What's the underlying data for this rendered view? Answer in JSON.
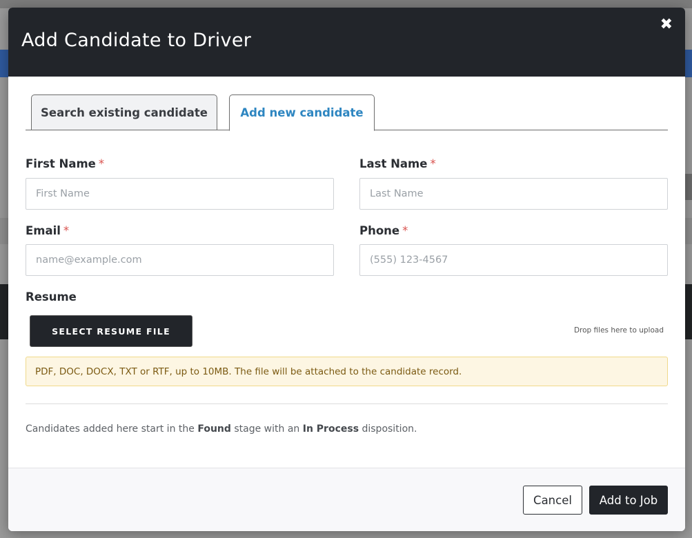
{
  "modal": {
    "title": "Add Candidate to Driver",
    "close_symbol": "✖"
  },
  "tabs": [
    {
      "label": "Search existing candidate",
      "active": false
    },
    {
      "label": "Add new candidate",
      "active": true
    }
  ],
  "form": {
    "first_name": {
      "label": "First Name",
      "required": "*",
      "placeholder": "First Name",
      "value": ""
    },
    "last_name": {
      "label": "Last Name",
      "required": "*",
      "placeholder": "Last Name",
      "value": ""
    },
    "email": {
      "label": "Email",
      "required": "*",
      "placeholder": "name@example.com",
      "value": ""
    },
    "phone": {
      "label": "Phone",
      "required": "*",
      "placeholder": "(555) 123-4567",
      "value": ""
    },
    "resume": {
      "label": "Resume",
      "button_label": "SELECT RESUME FILE",
      "dropzone_text": "Drop files here to upload",
      "hint": "PDF, DOC, DOCX, TXT or RTF, up to 10MB. The file will be attached to the candidate record."
    }
  },
  "note": {
    "prefix": "Candidates added here start in the ",
    "stage": "Found",
    "middle": " stage with an ",
    "disposition": "In Process",
    "suffix": " disposition."
  },
  "footer": {
    "cancel_label": "Cancel",
    "submit_label": "Add to Job"
  },
  "colors": {
    "header_bg": "#22252a",
    "active_tab": "#2e86c1",
    "required": "#d9534f",
    "alert_bg": "#fdf6e3"
  }
}
